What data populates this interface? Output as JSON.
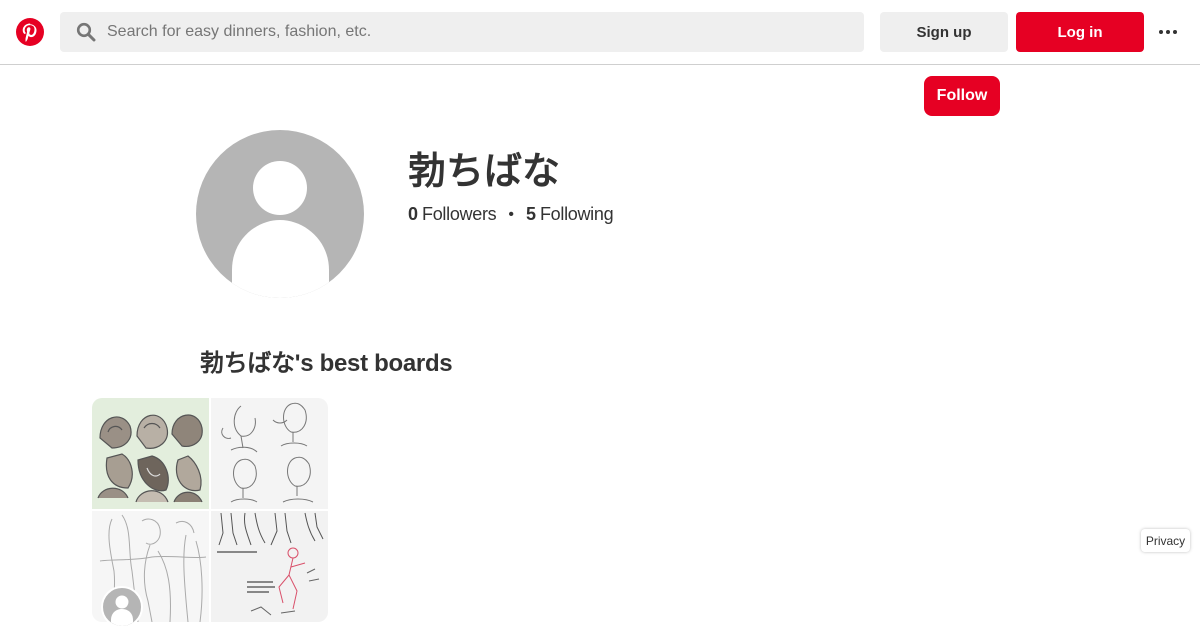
{
  "header": {
    "logo_icon": "pinterest-logo-icon",
    "search": {
      "icon": "search-icon",
      "value": "",
      "placeholder": "Search for easy dinners, fashion, etc."
    },
    "signup_label": "Sign up",
    "login_label": "Log in",
    "more_icon": "ellipsis-icon"
  },
  "colors": {
    "brand_red": "#e60023",
    "secondary_button": "#efefef",
    "avatar_placeholder": "#b5b5b5",
    "text": "#333333"
  },
  "profile": {
    "follow_label": "Follow",
    "avatar_icon": "default-avatar-icon",
    "name": "勃ちばな",
    "followers_count": "0",
    "followers_label": "Followers",
    "separator": "•",
    "following_count": "5",
    "following_label": "Following"
  },
  "boards": {
    "section_title": "勃ちばな's best boards",
    "items": [
      {
        "cover_images": [
          "hood-sketches",
          "face-angle-sketches",
          "body-pose-sketches",
          "leg-pose-sketches"
        ],
        "owner_avatar_icon": "default-avatar-icon"
      }
    ]
  },
  "footer": {
    "privacy_label": "Privacy"
  }
}
